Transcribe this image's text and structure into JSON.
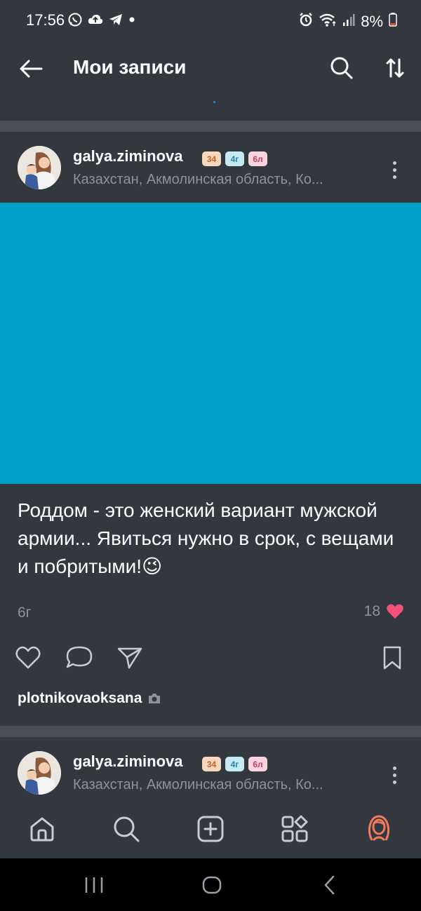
{
  "status": {
    "time": "17:56",
    "battery": "8%",
    "left_icons": [
      "whatsapp-icon",
      "cloud-upload-icon",
      "telegram-icon",
      "dot-icon"
    ],
    "right_icons": [
      "alarm-icon",
      "wifi-icon",
      "signal-icon",
      "battery-icon"
    ]
  },
  "header": {
    "title": "Мои записи",
    "icons": [
      "back-arrow-icon",
      "search-icon",
      "sort-icon"
    ]
  },
  "posts": [
    {
      "username": "galya.ziminova",
      "badges": [
        "34",
        "4г",
        "6л"
      ],
      "location": "Казахстан, Акмолинская область, Ко...",
      "image_color": "#00a0c8",
      "text": "Роддом - это женский вариант мужской армии... Явиться нужно в срок, с вещами и побритыми!😉",
      "age": "6г",
      "likes": "18",
      "liker": "plotnikovaoksana"
    },
    {
      "username": "galya.ziminova",
      "badges": [
        "34",
        "4г",
        "6л"
      ],
      "location": "Казахстан, Акмолинская область, Ко..."
    }
  ],
  "actions": [
    "heart-icon",
    "comment-icon",
    "share-icon",
    "bookmark-icon"
  ],
  "bottom_nav": [
    "home-icon",
    "search-icon",
    "add-icon",
    "services-icon",
    "profile-icon"
  ],
  "colors": {
    "background": "#33373e",
    "separator": "#4a4f57",
    "muted_text": "#8d939c",
    "like_heart": "#f2517a",
    "profile_accent": "#f07a5a"
  }
}
